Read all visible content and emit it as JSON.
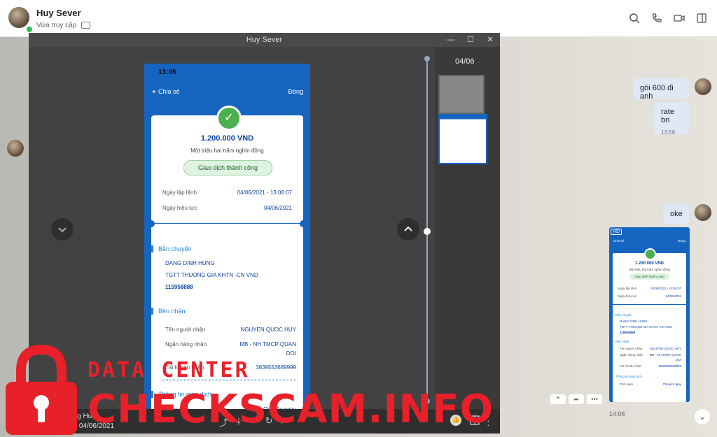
{
  "header": {
    "contact_name": "Huy Sever",
    "status_text": "Vừa truy cập"
  },
  "viewer": {
    "title": "Huy Sever",
    "counter": "04/06",
    "footer_sender": "ang Hun",
    "footer_date": "06 04/06/2021"
  },
  "receipt": {
    "time": "13:06",
    "share_label": "Chia sẻ",
    "close_label": "Đóng",
    "amount": "1.200.000 VND",
    "amount_words": "Một triệu hai trăm nghìn đồng",
    "status": "Giao dịch thành công",
    "order_date_label": "Ngày lập lệnh",
    "order_date": "04/06/2021 - 13:06:07",
    "effective_date_label": "Ngày hiệu lực",
    "effective_date": "04/06/2021",
    "sender_section": "Bên chuyển",
    "sender_name": "DANG DINH HUNG",
    "sender_account_name": "TGTT THUONG GIA KHTN -CN VND",
    "sender_account": "115958888",
    "receiver_section": "Bên nhận",
    "receiver_name_label": "Tên người nhận",
    "receiver_name": "NGUYEN QUOC HUY",
    "receiver_bank_label": "Ngân hàng nhận",
    "receiver_bank_line1": "MB - NH TMCP QUAN",
    "receiver_bank_line2": "DOI",
    "receiver_account_label": "Tài khoản nhận",
    "receiver_account": "3839553689999",
    "info_section": "Thông tin giao dịch",
    "time_label": "Thời gian",
    "type_value": "Chuyển ngay"
  },
  "messages": {
    "m1": "gói 600 đi anh",
    "m2": "rate bn",
    "m2_time": "13:59",
    "m3": "oke",
    "img_badge": "HD",
    "img_time": "14:06"
  },
  "watermark": {
    "line1": "DATA CENTER",
    "line2": "CHECKSCAM.INFO"
  }
}
